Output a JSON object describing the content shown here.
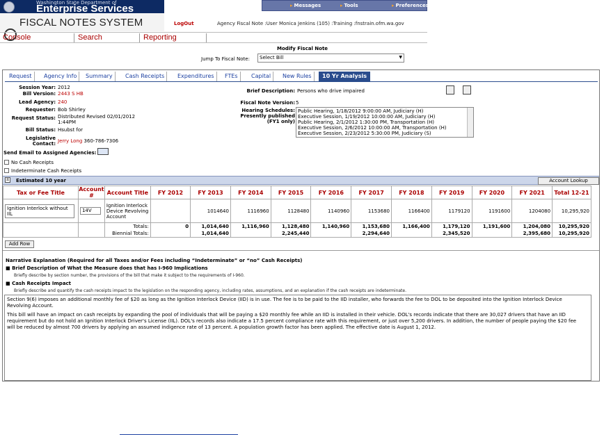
{
  "banner": {
    "state_dept": "Washington State Department of",
    "enterprise": "Enterprise Services",
    "app_title": "FISCAL NOTES SYSTEM",
    "logout": "LogOut",
    "agency_info": "Agency Fiscal Note :User Monica Jenkins (105) :Training :fnstrain.ofm.wa.gov"
  },
  "topnav": {
    "messages": "Messages",
    "tools": "Tools",
    "preferences": "Preferences"
  },
  "menu": {
    "console": "Console",
    "search": "Search",
    "reporting": "Reporting"
  },
  "page": {
    "title": "Modify Fiscal Note",
    "jump_label": "Jump To Fiscal Note:",
    "jump_value": "Select Bill"
  },
  "tabs": [
    "Request",
    "Agency Info",
    "Summary",
    "Cash Receipts",
    "Expenditures",
    "FTEs",
    "Capital",
    "New Rules",
    "10 Yr Analysis"
  ],
  "info": {
    "session_year_label": "Session Year:",
    "session_year": "2012",
    "bill_version_label": "Bill Version:",
    "bill_version": "2443 S HB",
    "lead_agency_label": "Lead Agency:",
    "lead_agency": "240",
    "requester_label": "Requester:",
    "requester": "Bob Shirley",
    "request_status_label": "Request Status:",
    "request_status_1": "Distributed Revised 02/01/2012",
    "request_status_2": "1:44PM",
    "bill_status_label": "Bill Status:",
    "bill_status": "Hsubst for",
    "leg_contact_label_1": "Legislative",
    "leg_contact_label_2": "Contact:",
    "leg_contact_name": "Jerry Long",
    "leg_contact_phone": "360-786-7306",
    "brief_desc_label": "Brief Description:",
    "brief_desc": "Persons who drive impaired",
    "fn_version_label": "Fiscal Note Version:",
    "fn_version": "5",
    "hearing_label": "Hearing Schedules:",
    "published_label_1": "Presently published",
    "published_label_2": "(FY1 only)",
    "hearings": [
      "Public Hearing, 1/18/2012 9:00:00 AM, Judiciary (H)",
      "Executive Session, 1/19/2012 10:00:00 AM, Judiciary (H)",
      "Public Hearing, 2/1/2012 1:30:00 PM, Transportation (H)",
      "Executive Session, 2/6/2012 10:00:00 AM, Transportation (H)",
      "Executive Session, 2/23/2012 5:30:00 PM, Judiciary (S)"
    ],
    "send_email_label": "Send Email to Assigned Agencies:",
    "no_cash_receipts": "No Cash Receipts",
    "indeterminate": "Indeterminate Cash Receipts"
  },
  "estimated": {
    "title": "Estimated 10 year",
    "account_lookup": "Account Lookup",
    "toggle": "±"
  },
  "table": {
    "headers": [
      "Tax or Fee Title",
      "Account #",
      "Account Title",
      "FY 2012",
      "FY 2013",
      "FY 2014",
      "FY 2015",
      "FY 2016",
      "FY 2017",
      "FY 2018",
      "FY 2019",
      "FY 2020",
      "FY 2021",
      "Total 12-21"
    ],
    "row": {
      "fee_title": "Ignition Interlock without IIL",
      "account": "14V",
      "account_title": "Ignition Interlock Device Revolving Account",
      "values": [
        "",
        "1014640",
        "1116960",
        "1128480",
        "1140960",
        "1153680",
        "1166400",
        "1179120",
        "1191600",
        "1204080",
        "10,295,920"
      ]
    },
    "totals_label": "Totals:",
    "totals": [
      "0",
      "1,014,640",
      "1,116,960",
      "1,128,480",
      "1,140,960",
      "1,153,680",
      "1,166,400",
      "1,179,120",
      "1,191,600",
      "1,204,080",
      "10,295,920"
    ],
    "biennial_label": "Biennial Totals:",
    "biennial": [
      "",
      "1,014,640",
      "",
      "2,245,440",
      "",
      "2,294,640",
      "",
      "2,345,520",
      "",
      "2,395,680",
      "10,295,920"
    ],
    "add_row": "Add Row"
  },
  "narrative": {
    "title": "Narrative Explanation (Required for all Taxes and/or Fees including “Indeterminate” or “no” Cash Receipts)",
    "h1": "Brief Description of What the Measure does that has I-960 Implications",
    "h1_sub": "Briefly describe by section number, the provisions of the bill that make it subject to the requirements of I-960.",
    "h2": "Cash Receipts Impact",
    "h2_sub": "Briefly describe and quantify the cash receipts impact to the legislation on the responding agency, including rates, assumptions, and an explanation if the cash receipts are indeterminate.",
    "p1": "Section 9(6) imposes an additional monthly fee of $20 as long as the Ignition Interlock Device (IID) is in use. The fee is to be paid to the IID installer, who forwards the fee to DOL to be deposited into the Ignition Interlock Device Revolving Account.",
    "p2": "This bill will have an impact on cash receipts by expanding the pool of individuals that will be paying a $20 monthly fee while an IID is installed in their vehicle. DOL's records indicate that there are 30,027 drivers that have an IID requirement but do not hold an Ignition Interlock Driver's License (IIL). DOL's records also indicate a 17.5 percent compliance rate with this requirement, or just over 5,200 drivers. In addition, the number of people paying the $20 fee will be reduced by almost 700 drivers by applying an assumed indigence rate of 13 percent. A population growth factor has been applied. The effective date is August 1, 2012."
  }
}
